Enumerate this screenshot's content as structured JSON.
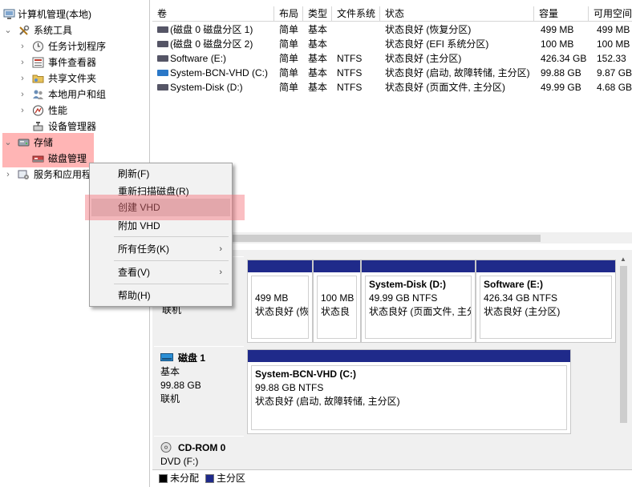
{
  "tree": {
    "root": "计算机管理(本地)",
    "system_tools": "系统工具",
    "items": [
      "任务计划程序",
      "事件查看器",
      "共享文件夹",
      "本地用户和组",
      "性能",
      "设备管理器"
    ],
    "storage": "存储",
    "disk_management": "磁盘管理",
    "services": "服务和应用程序"
  },
  "table": {
    "columns": [
      "卷",
      "布局",
      "类型",
      "文件系统",
      "状态",
      "容量",
      "可用空间"
    ],
    "rows": [
      {
        "name": "(磁盘 0 磁盘分区 1)",
        "layout": "简单",
        "type": "基本",
        "fs": "",
        "status": "状态良好 (恢复分区)",
        "capacity": "499 MB",
        "free": "499 MB"
      },
      {
        "name": "(磁盘 0 磁盘分区 2)",
        "layout": "简单",
        "type": "基本",
        "fs": "",
        "status": "状态良好 (EFI 系统分区)",
        "capacity": "100 MB",
        "free": "100 MB"
      },
      {
        "name": "Software (E:)",
        "layout": "简单",
        "type": "基本",
        "fs": "NTFS",
        "status": "状态良好 (主分区)",
        "capacity": "426.34 GB",
        "free": "152.33"
      },
      {
        "name": "System-BCN-VHD (C:)",
        "layout": "简单",
        "type": "基本",
        "fs": "NTFS",
        "status": "状态良好 (启动, 故障转储, 主分区)",
        "capacity": "99.88 GB",
        "free": "9.87 GB"
      },
      {
        "name": "System-Disk (D:)",
        "layout": "简单",
        "type": "基本",
        "fs": "NTFS",
        "status": "状态良好 (页面文件, 主分区)",
        "capacity": "49.99 GB",
        "free": "4.68 GB"
      }
    ]
  },
  "disk0": {
    "online": "联机",
    "parts": [
      {
        "title": "",
        "size": "499 MB",
        "status": "状态良好 (恢"
      },
      {
        "title": "",
        "size": "100 MB",
        "status": "状态良"
      },
      {
        "title": "System-Disk  (D:)",
        "size": "49.99 GB NTFS",
        "status": "状态良好 (页面文件, 主分"
      },
      {
        "title": "Software  (E:)",
        "size": "426.34 GB NTFS",
        "status": "状态良好 (主分区)"
      }
    ]
  },
  "disk1": {
    "name": "磁盘 1",
    "type": "基本",
    "size": "99.88 GB",
    "online": "联机",
    "part": {
      "title": "System-BCN-VHD  (C:)",
      "size": "99.88 GB NTFS",
      "status": "状态良好 (启动, 故障转储, 主分区)"
    }
  },
  "cdrom": {
    "name": "CD-ROM 0",
    "type": "DVD (F:)"
  },
  "legend": {
    "unallocated": "未分配",
    "primary": "主分区"
  },
  "menu": {
    "refresh": "刷新(F)",
    "rescan": "重新扫描磁盘(R)",
    "create_vhd": "创建 VHD",
    "attach_vhd": "附加 VHD",
    "all_tasks": "所有任务(K)",
    "view": "查看(V)",
    "help": "帮助(H)"
  },
  "colors": {
    "partition_bar": "#1f2a8a",
    "unallocated": "#000000",
    "highlight": "#ff7878"
  }
}
